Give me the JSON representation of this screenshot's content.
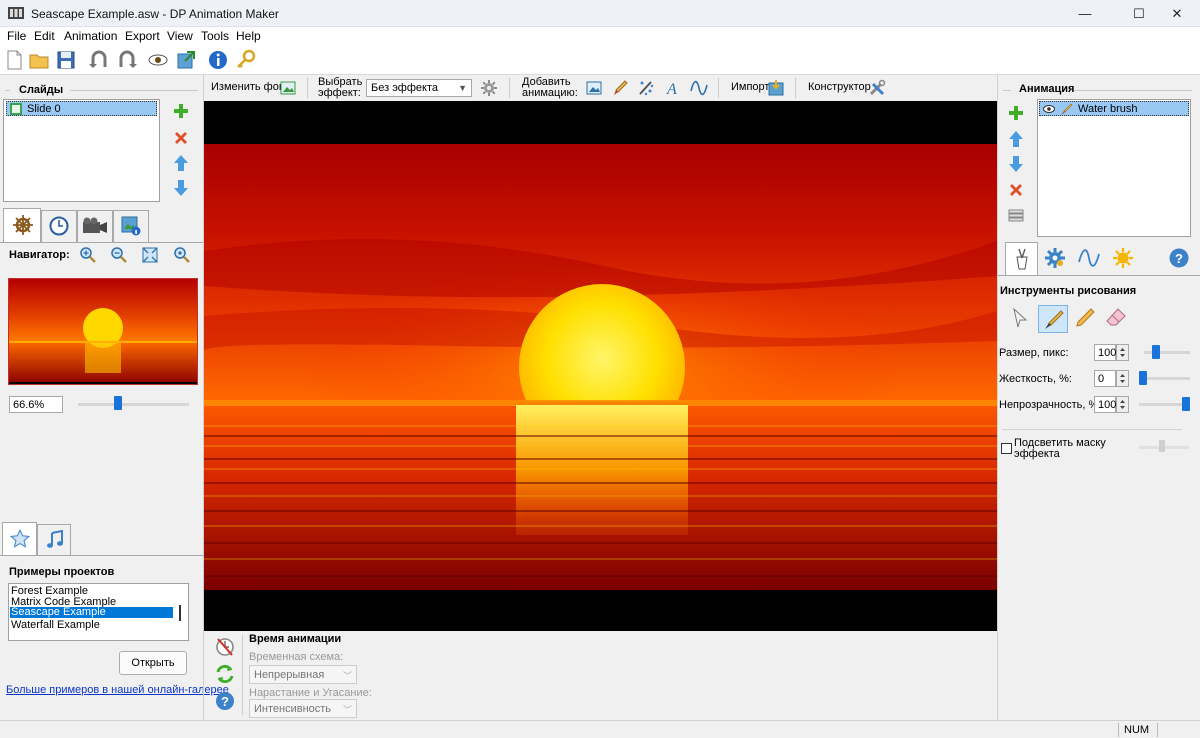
{
  "window": {
    "title": "Seascape Example.asw - DP Animation Maker",
    "minimize_glyph": "—",
    "maximize_glyph": "☐",
    "close_glyph": "✕"
  },
  "menu": [
    "File",
    "Edit",
    "Animation",
    "Export",
    "View",
    "Tools",
    "Help"
  ],
  "left": {
    "slides_header": "Слайды",
    "slides": [
      "Slide 0"
    ],
    "navigator_label": "Навигатор:",
    "zoom_value": "66.6%",
    "zoom_level": 0.3,
    "examples_header": "Примеры проектов",
    "examples": [
      "Forest Example",
      "Matrix Code Example",
      "Seascape Example",
      "Waterfall Example"
    ],
    "selected_example": "Seascape Example",
    "open_button": "Открыть",
    "gallery_link": "Больше примеров в нашей онлайн-галерее"
  },
  "center_toolbar": {
    "change_bg": "Изменить фон",
    "choose_effect_line1": "Выбрать",
    "choose_effect_line2": "эффект:",
    "effect_value": "Без эффекта",
    "add_anim_line1": "Добавить",
    "add_anim_line2": "анимацию:",
    "import": "Импорт",
    "constructor": "Конструктор"
  },
  "timing": {
    "header": "Время анимации",
    "scheme_label": "Временная схема:",
    "scheme_value": "Непрерывная",
    "fade_label": "Нарастание и Угасание:",
    "fade_value": "Интенсивность"
  },
  "right": {
    "anim_header": "Анимация",
    "anim_items": [
      "Water brush"
    ],
    "tools_header": "Инструменты рисования",
    "size_label": "Размер, пикс:",
    "size_value": "100",
    "size_level": 0.2,
    "hardness_label": "Жесткость, %:",
    "hardness_value": "0",
    "hardness_level": 0.0,
    "opacity_label": "Непрозрачность, %:",
    "opacity_value": "100",
    "opacity_level": 1.0,
    "mask_label_line1": "Подсветить маску",
    "mask_label_line2": "эффекта",
    "mask_checked": false
  },
  "status": {
    "num": "NUM"
  },
  "colors": {
    "accent": "#0078d7",
    "select": "#99c9f3",
    "canvas_bg": "#000000"
  },
  "icons": {
    "toolbar": [
      "new-file-icon",
      "open-folder-icon",
      "save-icon",
      "undo-icon",
      "redo-icon",
      "preview-eye-icon",
      "export-icon",
      "info-icon",
      "key-icon"
    ]
  }
}
